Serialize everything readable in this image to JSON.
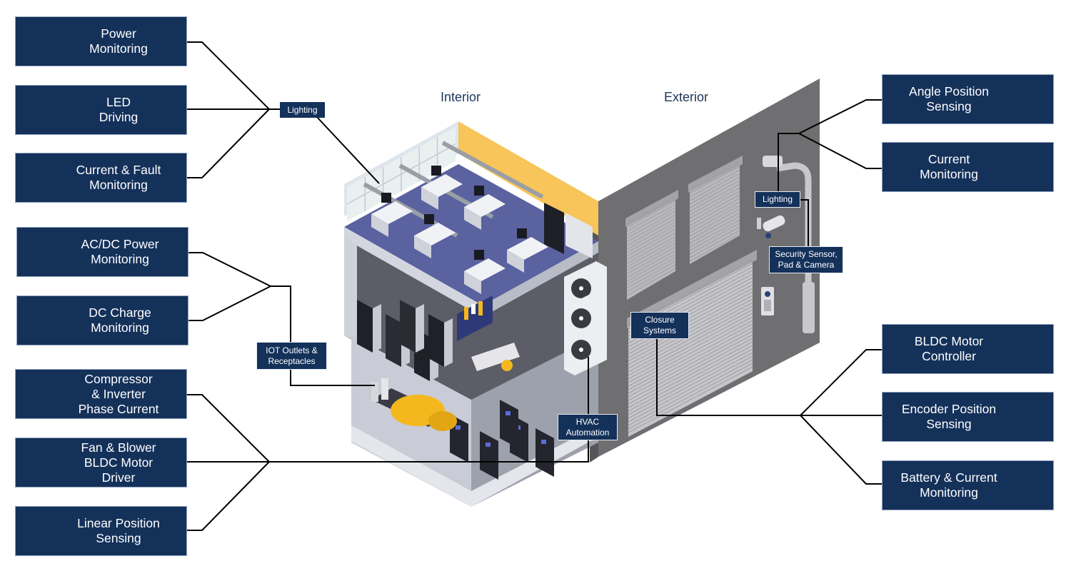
{
  "headings": {
    "interior": "Interior",
    "exterior": "Exterior"
  },
  "colors": {
    "box": "#14315a",
    "line": "#000000",
    "wall": "#6f6f71",
    "floor": "#5a62a0",
    "accent_yellow": "#f7c55a"
  },
  "left_groups": [
    {
      "hub_label": "Lighting",
      "items": [
        "Power\nMonitoring",
        "LED\nDriving",
        "Current & Fault\nMonitoring"
      ]
    },
    {
      "hub_label": "IOT Outlets &\nReceptacles",
      "items": [
        "AC/DC Power\nMonitoring",
        "DC Charge\nMonitoring"
      ]
    },
    {
      "hub_label": "HVAC\nAutomation",
      "items": [
        "Compressor\n& Inverter\nPhase Current",
        "Fan & Blower\nBLDC Motor\nDriver",
        "Linear Position\nSensing"
      ]
    }
  ],
  "right_groups": [
    {
      "hub_label": "Lighting",
      "secondary_label": "Security Sensor,\nPad & Camera",
      "items": [
        "Angle Position\nSensing",
        "Current\nMonitoring"
      ]
    },
    {
      "hub_label": "Closure\nSystems",
      "items": [
        "BLDC Motor\nController",
        "Encoder Position\nSensing",
        "Battery & Current\nMonitoring"
      ]
    }
  ]
}
